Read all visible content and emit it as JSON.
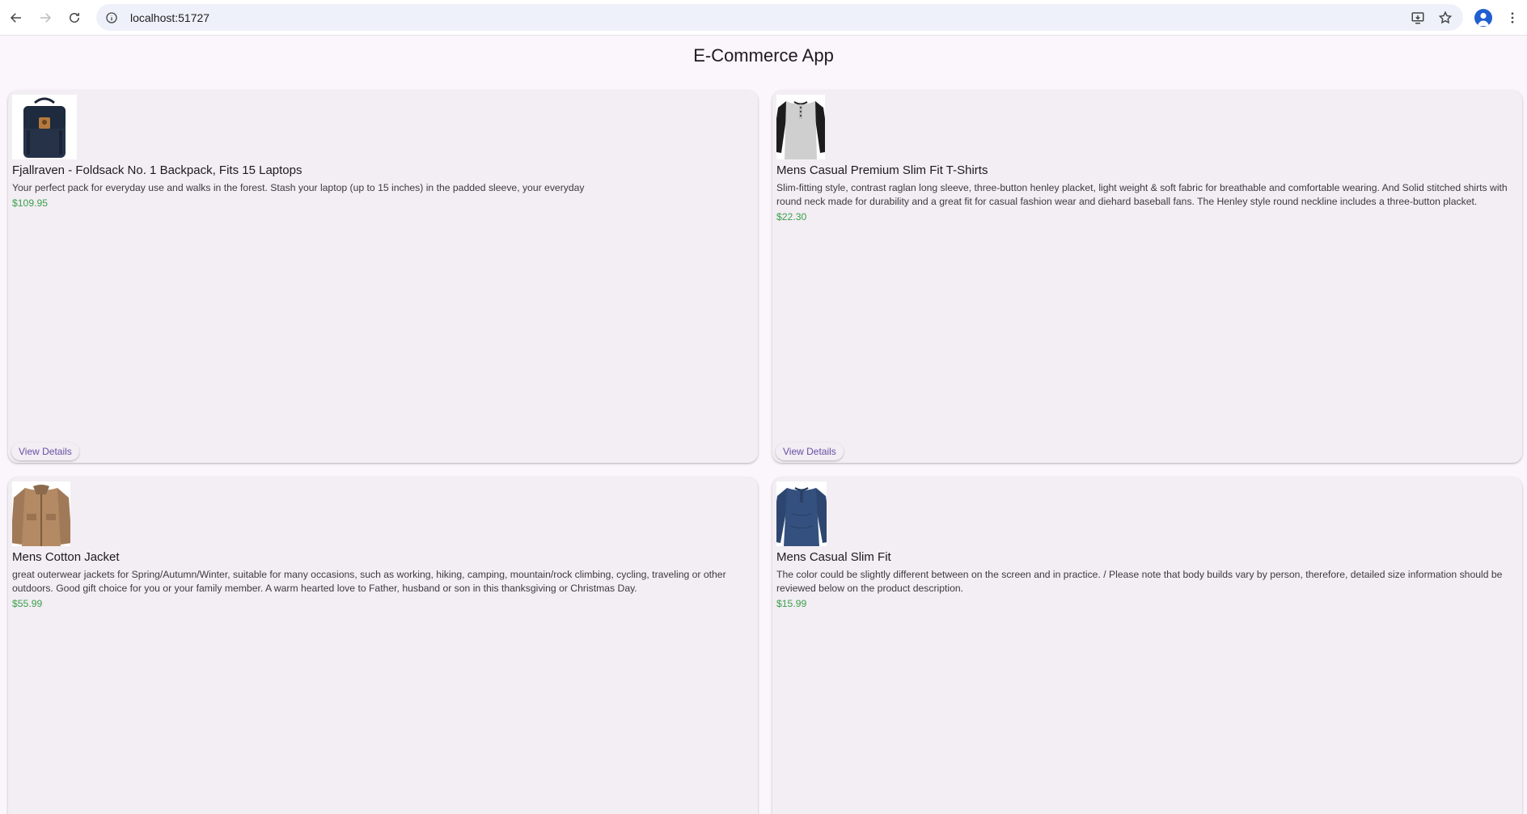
{
  "browser": {
    "url": "localhost:51727",
    "icons": [
      "back-icon",
      "forward-icon",
      "reload-icon",
      "info-icon",
      "install-icon",
      "star-icon",
      "profile-icon",
      "menu-icon"
    ]
  },
  "app": {
    "title": "E-Commerce App"
  },
  "products": [
    {
      "name": "Fjallraven - Foldsack No. 1 Backpack, Fits 15 Laptops",
      "description": "Your perfect pack for everyday use and walks in the forest. Stash your laptop (up to 15 inches) in the padded sleeve, your everyday",
      "price": "$109.95",
      "button": "View Details",
      "image": "backpack"
    },
    {
      "name": "Mens Casual Premium Slim Fit T-Shirts",
      "description": "Slim-fitting style, contrast raglan long sleeve, three-button henley placket, light weight & soft fabric for breathable and comfortable wearing. And Solid stitched shirts with round neck made for durability and a great fit for casual fashion wear and diehard baseball fans. The Henley style round neckline includes a three-button placket.",
      "price": "$22.30",
      "button": "View Details",
      "image": "raglan-shirt"
    },
    {
      "name": "Mens Cotton Jacket",
      "description": "great outerwear jackets for Spring/Autumn/Winter, suitable for many occasions, such as working, hiking, camping, mountain/rock climbing, cycling, traveling or other outdoors. Good gift choice for you or your family member. A warm hearted love to Father, husband or son in this thanksgiving or Christmas Day.",
      "price": "$55.99",
      "button": "View Details",
      "image": "jacket"
    },
    {
      "name": "Mens Casual Slim Fit",
      "description": "The color could be slightly different between on the screen and in practice. / Please note that body builds vary by person, therefore, detailed size information should be reviewed below on the product description.",
      "price": "$15.99",
      "button": "View Details",
      "image": "long-sleeve-shirt"
    }
  ],
  "colors": {
    "price": "#3aa14a",
    "button_text": "#6750a4",
    "card_bg": "#f3edf4",
    "page_bg": "#fbf5fc"
  }
}
